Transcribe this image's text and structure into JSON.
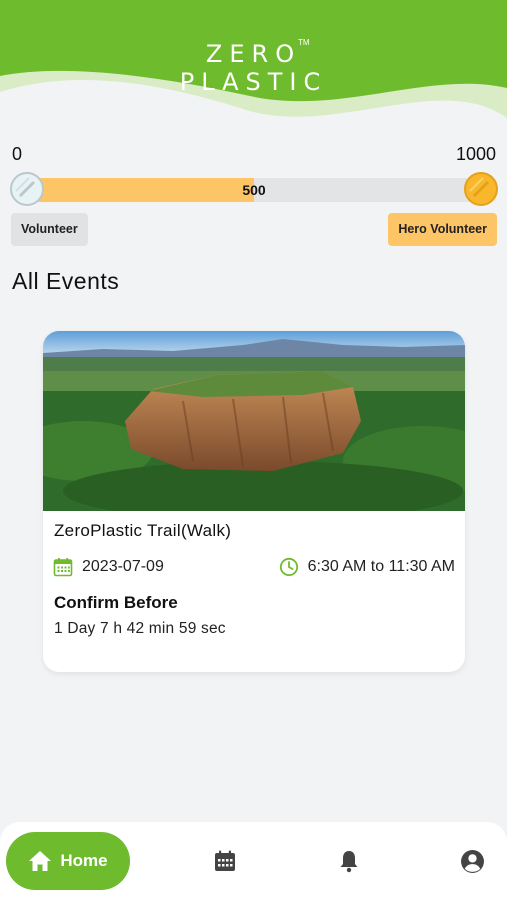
{
  "header": {
    "logo_line1": "ZERO",
    "logo_line2": "PLASTIC",
    "logo_tm": "TM",
    "colors": {
      "green": "#6fbb2e",
      "light_green": "#d9ecc6"
    }
  },
  "progress": {
    "min_label": "0",
    "max_label": "1000",
    "current_label": "500",
    "current_value": 500,
    "max_value": 1000,
    "fill_color": "#fdc566",
    "left_level": "Volunteer",
    "right_level": "Hero Volunteer"
  },
  "events": {
    "section_title": "All Events",
    "items": [
      {
        "title": "ZeroPlastic Trail(Walk)",
        "date": "2023-07-09",
        "time": "6:30 AM to 11:30 AM",
        "confirm_label": "Confirm Before",
        "countdown": "1 Day 7 h 42 min 59 sec",
        "icon_color": "#6fbb2e"
      }
    ]
  },
  "nav": {
    "home_label": "Home",
    "icons": [
      "home-icon",
      "calendar-icon",
      "bell-icon",
      "account-icon"
    ]
  }
}
